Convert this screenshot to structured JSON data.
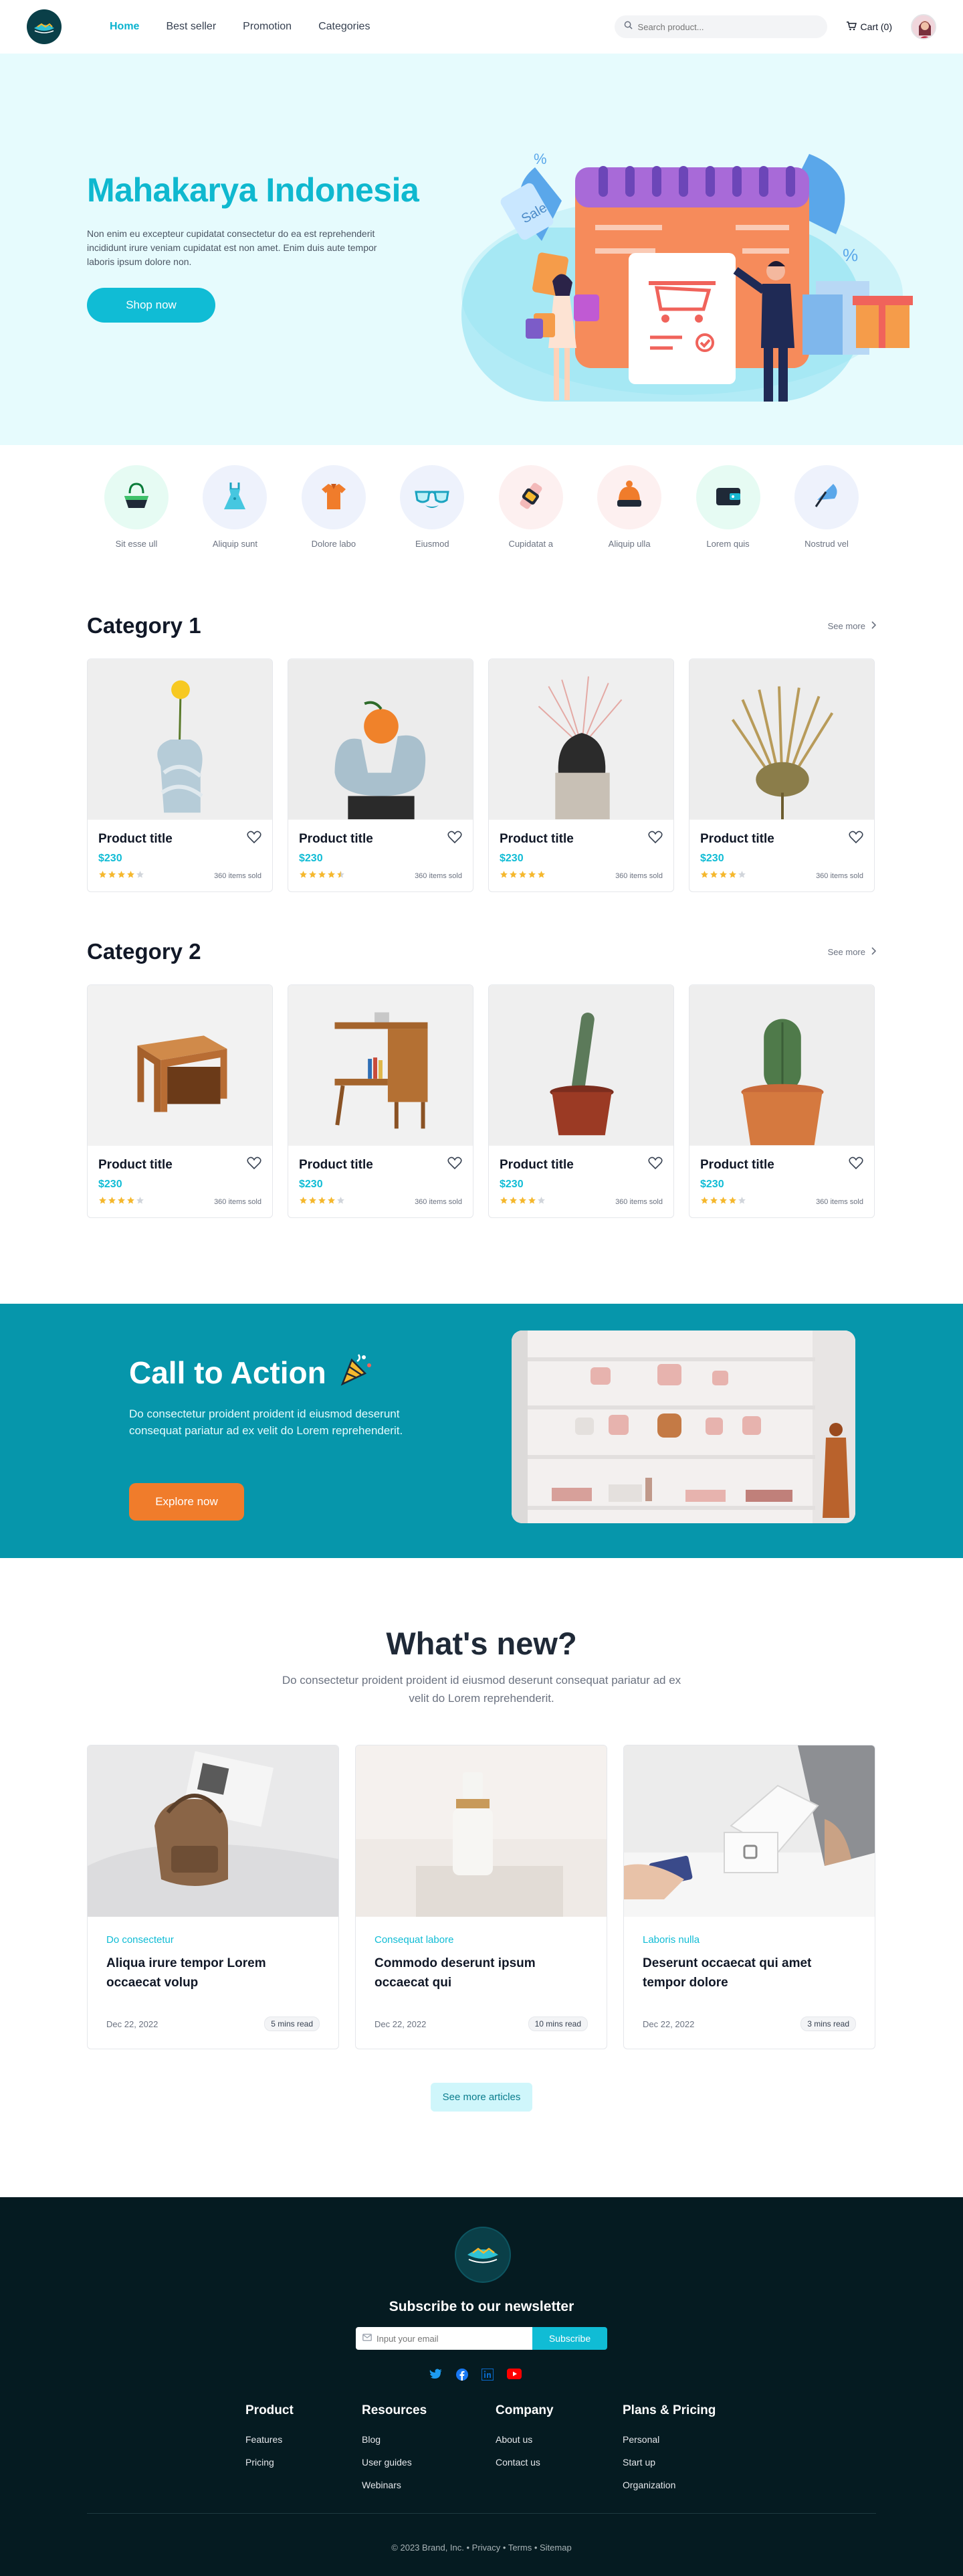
{
  "nav": {
    "links": [
      "Home",
      "Best seller",
      "Promotion",
      "Categories"
    ],
    "search_placeholder": "Search product...",
    "cart_label": "Cart (0)"
  },
  "hero": {
    "title": "Mahakarya Indonesia",
    "description": "Non enim eu excepteur cupidatat consectetur do ea est reprehenderit incididunt irure veniam cupidatat est non amet. Enim duis aute tempor laboris ipsum dolore non.",
    "cta": "Shop now",
    "illustration_texts": {
      "sale_tag": "Sale",
      "percent": "%"
    }
  },
  "categories": [
    {
      "label": "Sit esse ull",
      "icon": "bag-icon",
      "bg": "#e6fbf3"
    },
    {
      "label": "Aliquip sunt",
      "icon": "dress-icon",
      "bg": "#eef2fc"
    },
    {
      "label": "Dolore labo",
      "icon": "shirt-icon",
      "bg": "#eef2fc"
    },
    {
      "label": "Eiusmod",
      "icon": "glasses-icon",
      "bg": "#eef2fc"
    },
    {
      "label": "Cupidatat a",
      "icon": "watch-icon",
      "bg": "#fdf0f0"
    },
    {
      "label": "Aliquip ulla",
      "icon": "beanie-icon",
      "bg": "#fdf0f0"
    },
    {
      "label": "Lorem quis",
      "icon": "wallet-icon",
      "bg": "#e6fbf3"
    },
    {
      "label": "Nostrud vel",
      "icon": "umbrella-icon",
      "bg": "#eef2fc"
    }
  ],
  "section1": {
    "title": "Category 1",
    "see_more": "See more",
    "products": [
      {
        "title": "Product title",
        "price": "$230",
        "rating": 4,
        "sold": "360 items sold"
      },
      {
        "title": "Product title",
        "price": "$230",
        "rating": 4.5,
        "sold": "360 items sold"
      },
      {
        "title": "Product title",
        "price": "$230",
        "rating": 5,
        "sold": "360 items sold"
      },
      {
        "title": "Product title",
        "price": "$230",
        "rating": 4,
        "sold": "360 items sold"
      }
    ]
  },
  "section2": {
    "title": "Category 2",
    "see_more": "See more",
    "products": [
      {
        "title": "Product title",
        "price": "$230",
        "rating": 4,
        "sold": "360 items sold"
      },
      {
        "title": "Product title",
        "price": "$230",
        "rating": 4,
        "sold": "360 items sold"
      },
      {
        "title": "Product title",
        "price": "$230",
        "rating": 4,
        "sold": "360 items sold"
      },
      {
        "title": "Product title",
        "price": "$230",
        "rating": 4,
        "sold": "360 items sold"
      }
    ]
  },
  "cta": {
    "title": "Call to Action",
    "description": "Do consectetur proident proident id eiusmod deserunt consequat pariatur ad ex velit do Lorem reprehenderit.",
    "button": "Explore now"
  },
  "whats_new": {
    "title": "What's new?",
    "subtitle": "Do consectetur proident proident id eiusmod deserunt consequat pariatur ad ex velit do Lorem reprehenderit.",
    "articles": [
      {
        "category": "Do consectetur",
        "title": "Aliqua irure tempor Lorem occaecat volup",
        "date": "Dec 22, 2022",
        "read": "5 mins read"
      },
      {
        "category": "Consequat labore",
        "title": "Commodo deserunt ipsum occaecat qui",
        "date": "Dec 22, 2022",
        "read": "10 mins read"
      },
      {
        "category": "Laboris nulla",
        "title": "Deserunt occaecat qui amet tempor dolore",
        "date": "Dec 22, 2022",
        "read": "3 mins read"
      }
    ],
    "see_more": "See more articles"
  },
  "footer": {
    "newsletter_title": "Subscribe to our newsletter",
    "email_placeholder": "Input your email",
    "subscribe": "Subscribe",
    "columns": [
      {
        "title": "Product",
        "links": [
          "Features",
          "Pricing"
        ]
      },
      {
        "title": "Resources",
        "links": [
          "Blog",
          "User guides",
          "Webinars"
        ]
      },
      {
        "title": "Company",
        "links": [
          "About us",
          "Contact us"
        ]
      },
      {
        "title": "Plans & Pricing",
        "links": [
          "Personal",
          "Start up",
          "Organization"
        ]
      }
    ],
    "copyright": "© 2023 Brand, Inc. • Privacy • Terms • Sitemap"
  },
  "colors": {
    "accent": "#10bcd5",
    "cta_bg": "#0696ab",
    "footer_bg": "#051b21",
    "orange": "#f07c2b",
    "star": "#f5b82e"
  }
}
